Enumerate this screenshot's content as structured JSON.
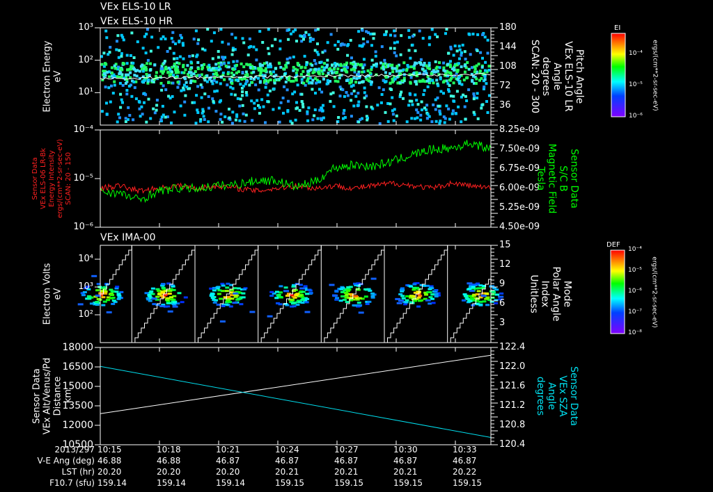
{
  "titles": {
    "p1a": "VEx ELS-10 LR",
    "p1b": "VEx ELS-10 HR",
    "p3": "VEx IMA-00"
  },
  "colors": {
    "red": "#ff2020",
    "green": "#00ff00",
    "cyan": "#00e0f0",
    "white": "#ffffff"
  },
  "chart_data": [
    {
      "type": "heatmap",
      "name": "electron-energy-spectrogram",
      "ylabel": "Electron Energy\neV",
      "yticks": [
        "10³",
        "10²",
        "10¹"
      ],
      "ylim": [
        1,
        1000
      ],
      "yscale": "log",
      "right_label": "Pitch Angle\nVEx ELS-10 LR\nAngle\ndegrees\nSCAN: 20 - 300",
      "right_ticks": [
        "180",
        "144",
        "108",
        "72",
        "36"
      ],
      "colorbar": {
        "title": "EI",
        "ticks": [
          "10⁻⁴",
          "10⁻⁵",
          "10⁻⁶"
        ],
        "units": "ergs/(cm**2-sr-sec-eV)"
      },
      "band_energy_eV": [
        30,
        40
      ],
      "pitch_angle_line_deg": [
        95,
        105
      ]
    },
    {
      "type": "line",
      "name": "energy-intensity-and-magnetic-field",
      "ylabel": "Sensor Data\nVEx ELS-06 LR-Bk\nEnergy Intensity\nergs/(cm**2-sr-sec-eV)\nSCAN: 20 - 150",
      "yticks": [
        "10⁻⁴",
        "10⁻⁵",
        "10⁻⁶"
      ],
      "ylim": [
        1e-06,
        0.0001
      ],
      "right_label": "Sensor Data\nS/C B\nMagnetic Field\nTesla",
      "right_ticks": [
        "8.25e-09",
        "7.50e-09",
        "6.75e-09",
        "6.00e-09",
        "5.25e-09",
        "4.50e-09"
      ],
      "right_ylim": [
        4.5e-09,
        8.25e-09
      ],
      "series": [
        {
          "name": "Energy Intensity",
          "color": "red",
          "values": [
            6e-09,
            6.1e-09,
            5.9e-09,
            6e-09,
            6.1e-09,
            6e-09,
            6.1e-09,
            6e-09,
            5.9e-09,
            6e-09,
            6.1e-09,
            6e-09,
            6.1e-09,
            6e-09,
            6.1e-09,
            6.2e-09,
            6.1e-09,
            6e-09,
            6.2e-09,
            6.1e-09,
            6e-09
          ]
        },
        {
          "name": "S/C B Magnetic Field",
          "color": "green",
          "values": [
            5.9e-09,
            5.8e-09,
            5.55e-09,
            5.9e-09,
            6e-09,
            6e-09,
            6.1e-09,
            6.15e-09,
            6.3e-09,
            6.3e-09,
            6.05e-09,
            6.25e-09,
            6.8e-09,
            6.9e-09,
            6.85e-09,
            7.05e-09,
            7.3e-09,
            7.5e-09,
            7.55e-09,
            7.75e-09,
            7.5e-09
          ]
        }
      ]
    },
    {
      "type": "heatmap",
      "name": "ima-electron-volts-spectrogram",
      "ylabel": "Electron Volts\neV",
      "yticks": [
        "10⁴",
        "10³",
        "10²"
      ],
      "ylim": [
        20,
        40000
      ],
      "yscale": "log",
      "right_label": "Mode\nPolar Angle\nIndex\nUnitless",
      "right_ticks": [
        "15",
        "12",
        "9",
        "6",
        "3"
      ],
      "right_ylim": [
        0,
        15
      ],
      "colorbar": {
        "title": "DEF",
        "ticks": [
          "10⁻⁴",
          "10⁻⁵",
          "10⁻⁶",
          "10⁻⁷",
          "10⁻⁸"
        ],
        "units": "ergs/(cm**2-sr-sec-eV)"
      },
      "blob_centers_min": [
        0,
        3.2,
        6.4,
        9.6,
        12.8,
        16.0,
        19.2
      ],
      "blob_energy_eV": 300
    },
    {
      "type": "line",
      "name": "altitude-and-sza",
      "ylabel": "Sensor Data\nVEx Alt/Venus/Pd\nDistance\nkm",
      "yticks": [
        "18000",
        "16500",
        "15000",
        "13500",
        "12000",
        "10500"
      ],
      "ylim": [
        10500,
        18000
      ],
      "right_label": "Sensor Data\nVEx SZA\nAngle\ndegrees",
      "right_ticks": [
        "122.4",
        "122.0",
        "121.6",
        "121.2",
        "120.8",
        "120.4"
      ],
      "right_ylim": [
        120.4,
        122.4
      ],
      "series": [
        {
          "name": "Altitude",
          "color": "white",
          "values": [
            12900,
            17400
          ]
        },
        {
          "name": "SZA",
          "color": "cyan",
          "values": [
            122.01,
            120.55
          ]
        }
      ]
    }
  ],
  "time_axis": {
    "header": "2013/297",
    "ticks": [
      "10:15",
      "10:18",
      "10:21",
      "10:24",
      "10:27",
      "10:30",
      "10:33"
    ],
    "rows": [
      {
        "label": "V-E Ang (deg)",
        "values": [
          "46.88",
          "46.88",
          "46.87",
          "46.87",
          "46.87",
          "46.87",
          "46.87"
        ]
      },
      {
        "label": "LST (hr)",
        "values": [
          "20.20",
          "20.20",
          "20.20",
          "20.21",
          "20.21",
          "20.21",
          "20.22"
        ]
      },
      {
        "label": "F10.7 (sfu)",
        "values": [
          "159.14",
          "159.14",
          "159.14",
          "159.15",
          "159.15",
          "159.15",
          "159.15"
        ]
      }
    ]
  }
}
